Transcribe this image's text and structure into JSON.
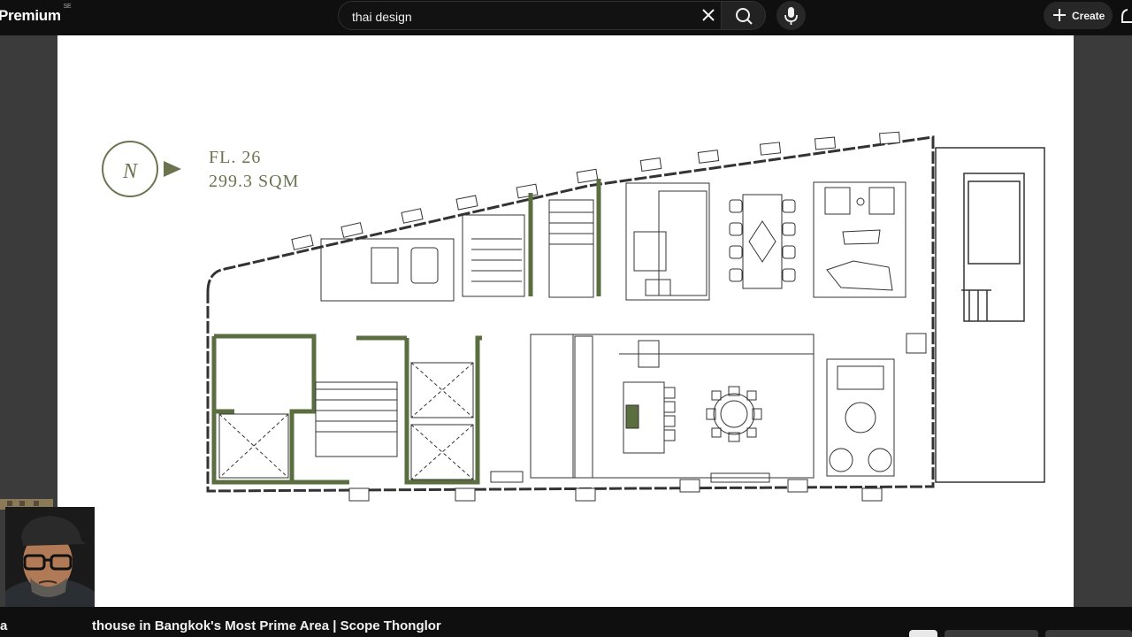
{
  "header": {
    "logo_text": "Premium",
    "logo_sup": "SE",
    "search_value": "thai design",
    "create_label": "Create"
  },
  "plan": {
    "floor_label": "FL. 26",
    "area_label": "299.3 SQM",
    "north_label": "N",
    "colors": {
      "accent": "#5b6e3f",
      "line": "#333333",
      "label": "#6a7550"
    }
  },
  "video": {
    "title_fragment": "a",
    "title": "thouse in Bangkok's Most Prime Area | Scope Thonglor"
  }
}
